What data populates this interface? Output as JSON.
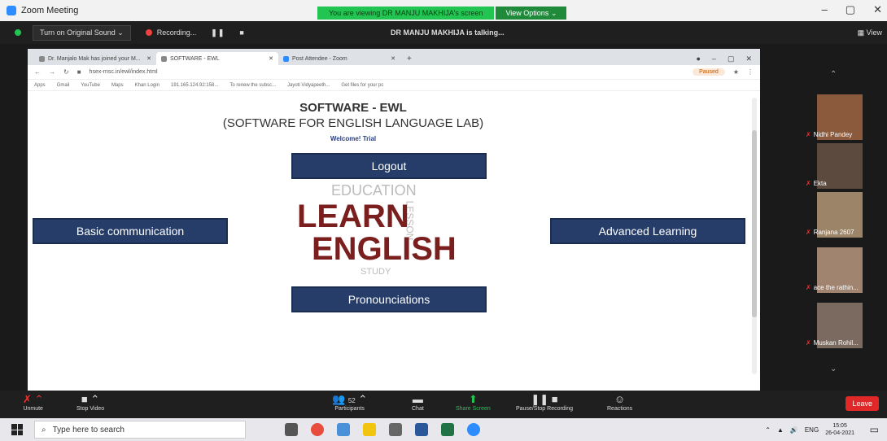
{
  "titlebar": {
    "app_title": "Zoom Meeting",
    "viewing_text": "You are viewing DR MANJU MAKHIJA's screen",
    "view_options": "View Options ⌄",
    "minimize": "–",
    "maximize": "▢",
    "close": "✕"
  },
  "zoom_top": {
    "original_sound": "Turn on Original Sound ⌄",
    "recording": "Recording...",
    "talking": "DR MANJU MAKHIJA is talking...",
    "view": "View"
  },
  "browser": {
    "tabs": [
      {
        "label": "Dr. Manjalo Mak has joined your M..."
      },
      {
        "label": "SOFTWARE - EWL"
      },
      {
        "label": "Post Attendee - Zoom"
      }
    ],
    "url": "hsex-rnsc.in/ewl/index.html",
    "profile": "Paused",
    "bookmarks": [
      "Apps",
      "Gmail",
      "YouTube",
      "Maps",
      "Khan Login",
      "191.165.124.92:158...",
      "To renew the subsc...",
      "Jayoti Vidyapeeth...",
      "Get files for your pc"
    ]
  },
  "page": {
    "title": "SOFTWARE - EWL",
    "subtitle": "(SOFTWARE FOR ENGLISH LANGUAGE LAB)",
    "welcome": "Welcome!   Trial",
    "logout": "Logout",
    "basic": "Basic communication",
    "advanced": "Advanced Learning",
    "pronunciations": "Pronounciations",
    "cloud_learn": "LEARN",
    "cloud_english": "ENGLISH",
    "cloud_education": "EDUCATION",
    "cloud_study": "STUDY",
    "cloud_lesson": "LESSON"
  },
  "participants": [
    {
      "name": "Nidhi Pandey",
      "color": "#8b5a3c"
    },
    {
      "name": "Ekta",
      "color": "#5c4a3e"
    },
    {
      "name": "Ranjana 2607",
      "color": "#9c8468"
    },
    {
      "name": "ace the rathin...",
      "color": "#a08470"
    },
    {
      "name": "Muskan Rohil...",
      "color": "#7a6a60"
    }
  ],
  "toolbar": {
    "unmute": "Unmute",
    "stop_video": "Stop Video",
    "participants": "Participants",
    "participants_count": "52",
    "chat": "Chat",
    "share_screen": "Share Screen",
    "pause_recording": "Pause/Stop Recording",
    "reactions": "Reactions",
    "leave": "Leave"
  },
  "taskbar": {
    "search_placeholder": "Type here to search",
    "lang": "ENG",
    "time": "15:05",
    "date": "26-04-2021"
  },
  "colors": {
    "nav_button": "#263d69",
    "zoom_green": "#23c552",
    "leave_red": "#e02828",
    "cloud_maroon": "#7a1e1e"
  }
}
